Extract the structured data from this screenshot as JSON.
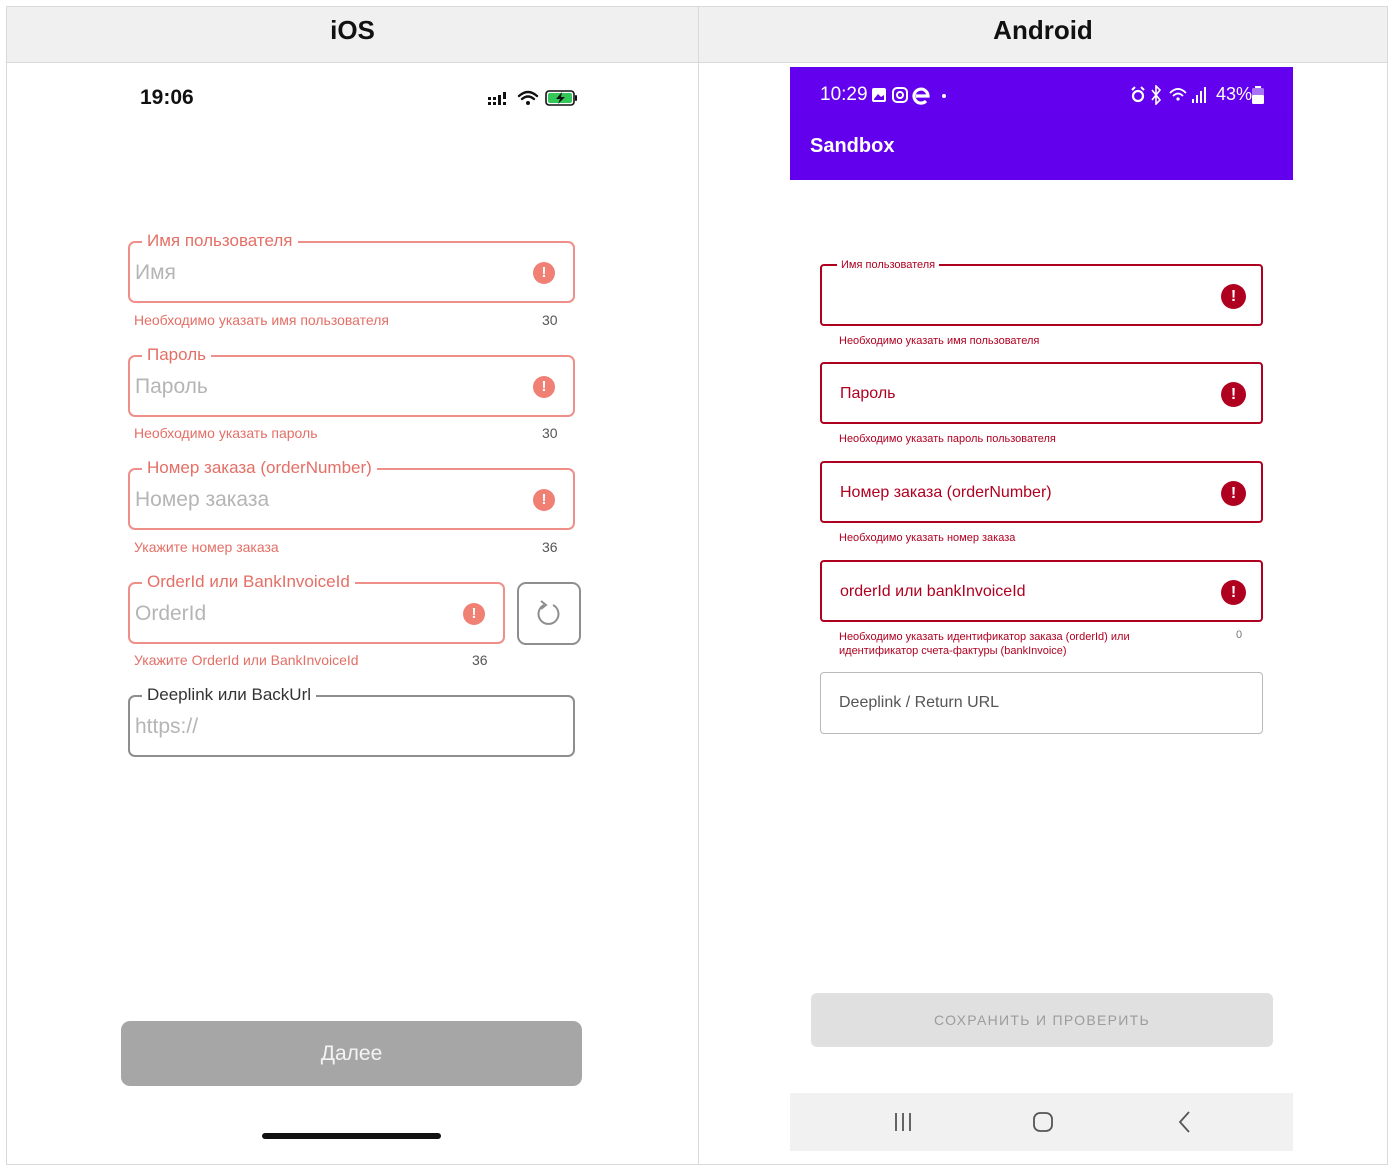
{
  "columns": {
    "ios": "iOS",
    "android": "Android"
  },
  "ios": {
    "status": {
      "time": "19:06"
    },
    "fields": [
      {
        "legend": "Имя пользователя",
        "placeholder": "Имя",
        "helper": "Необходимо указать имя пользователя",
        "counter": "30"
      },
      {
        "legend": "Пароль",
        "placeholder": "Пароль",
        "helper": "Необходимо указать пароль",
        "counter": "30"
      },
      {
        "legend": "Номер заказа (orderNumber)",
        "placeholder": "Номер заказа",
        "helper": "Укажите номер заказа",
        "counter": "36"
      },
      {
        "legend": "OrderId или BankInvoiceId",
        "placeholder": "OrderId",
        "helper": "Укажите OrderId или BankInvoiceId",
        "counter": "36"
      },
      {
        "legend": "Deeplink или BackUrl",
        "placeholder": "https://"
      }
    ],
    "error_glyph": "!",
    "next_button": "Далее",
    "colors": {
      "error": "#e46f66",
      "button": "#a6a6a6"
    }
  },
  "android": {
    "status": {
      "time": "10:29",
      "battery": "43%"
    },
    "app_title": "Sandbox",
    "fields": [
      {
        "legend": "Имя пользователя",
        "helper": "Необходимо указать имя пользователя"
      },
      {
        "label": "Пароль",
        "helper": "Необходимо указать пароль пользователя"
      },
      {
        "label": "Номер заказа (orderNumber)",
        "helper": "Необходимо указать номер заказа"
      },
      {
        "label": "orderId или bankInvoiceId",
        "helper": "Необходимо указать идентификатор заказа (orderId) или идентификатор счета-фактуры (bankInvoice)",
        "counter": "0"
      },
      {
        "label": "Deeplink / Return URL"
      }
    ],
    "error_glyph": "!",
    "save_button": "СОХРАНИТЬ И ПРОВЕРИТЬ",
    "colors": {
      "primary": "#6200ee",
      "error": "#b00020"
    }
  }
}
